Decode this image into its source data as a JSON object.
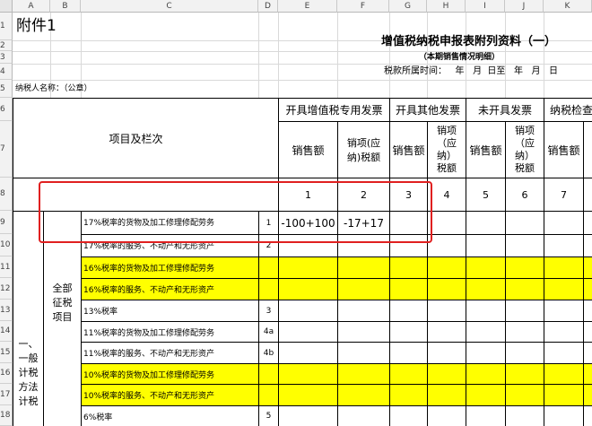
{
  "sheet": {
    "columns": [
      "A",
      "B",
      "C",
      "D",
      "E",
      "F",
      "G",
      "H",
      "I",
      "J",
      "K"
    ],
    "rows": [
      "1",
      "2",
      "3",
      "4",
      "5",
      "6",
      "7",
      "8",
      "9",
      "10",
      "11",
      "12",
      "13",
      "14",
      "15",
      "16",
      "17",
      "18"
    ]
  },
  "doc": {
    "attachment": "附件1",
    "title": "增值税纳税申报表附列资料（一）",
    "subtitle": "（本期销售情况明细）",
    "period": "税款所属时间：   年   月  日至   年   月   日",
    "taxpayer": "纳税人名称：（公章）"
  },
  "header": {
    "item_label": "项目及栏次",
    "group1": "开具增值税专用发票",
    "group2": "开具其他发票",
    "group3": "未开具发票",
    "group4": "纳税检查",
    "sales": "销售额",
    "tax_a": "销项(应纳)税额",
    "tax_b": "销项（应纳）税额",
    "nums": [
      "1",
      "2",
      "3",
      "4",
      "5",
      "6",
      "7"
    ]
  },
  "left": {
    "category": "一、一般计税方法计税",
    "subcategory": "全部征税项目"
  },
  "rows": [
    {
      "label": "17%税率的货物及加工修理修配劳务",
      "num": "1",
      "v1": "-100+100",
      "v2": "-17+17"
    },
    {
      "label": "17%税率的服务、不动产和无形资产",
      "num": "2"
    },
    {
      "label": "16%税率的货物及加工修理修配劳务",
      "num": ""
    },
    {
      "label": "16%税率的服务、不动产和无形资产",
      "num": ""
    },
    {
      "label": "13%税率",
      "num": "3"
    },
    {
      "label": "11%税率的货物及加工修理修配劳务",
      "num": "4a"
    },
    {
      "label": "11%税率的服务、不动产和无形资产",
      "num": "4b"
    },
    {
      "label": "10%税率的货物及加工修理修配劳务",
      "num": ""
    },
    {
      "label": "10%税率的服务、不动产和无形资产",
      "num": ""
    },
    {
      "label": "6%税率",
      "num": "5"
    }
  ],
  "colors": {
    "highlight": "#ffff00",
    "annotation": "#e02020"
  }
}
